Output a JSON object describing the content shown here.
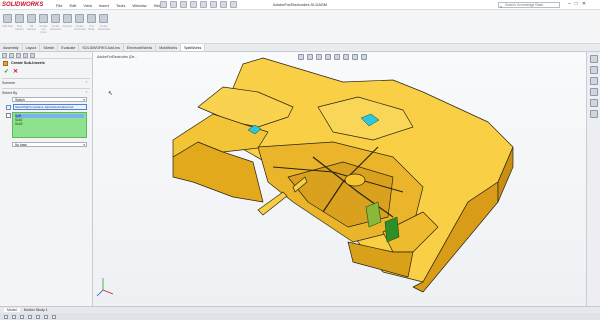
{
  "app": {
    "logo_text": "SOLIDWORKS",
    "document_title": "AdobeForElectrodes.SLDASM"
  },
  "menu": [
    "File",
    "Edit",
    "View",
    "Insert",
    "Tools",
    "Window",
    "Help"
  ],
  "search": {
    "placeholder": "Search Knowledge Base"
  },
  "ribbon": {
    "buttons": [
      "Split Part",
      "Plug Hole(s)",
      "Fill Surface",
      "Create Cut-Lines",
      "Create Extension",
      "Fill Face",
      "Create Protrusion",
      "Trim Body",
      "Create Electrodes"
    ]
  },
  "command_tabs": [
    "Assembly",
    "Layout",
    "Sketch",
    "Evaluate",
    "SOLIDWORKS Add-Ins",
    "ElectrodeWorks",
    "MoldWorks",
    "SplitWorks"
  ],
  "active_command_tab": "SplitWorks",
  "property_manager": {
    "title": "Create Sub-Inserts",
    "scheme_label": "Scheme",
    "select_by_label": "Select By",
    "select_by_value": "Sketch",
    "sketch_selection": "Sketch6@Constrain1-1@AdobeForElectrod",
    "items": [
      "Split",
      "Sub2",
      "Sub3"
    ],
    "selected_item": "Split",
    "bottom_option": "No base"
  },
  "viewport": {
    "breadcrumb": "AdobeForElectrodes (De..."
  },
  "bottom_tabs": [
    "Model",
    "Motion Study 1"
  ],
  "active_bottom_tab": "Model",
  "colors": {
    "part_body": "#f6c531",
    "part_edge": "#2a2410",
    "highlight_teal": "#2fc6dc",
    "electrode_green": "#4cb334",
    "list_green": "#8ee28e"
  },
  "icons": [
    "search-icon",
    "ok-checkmark-icon",
    "cancel-x-icon",
    "coordinate-axes-icon",
    "cursor-icon"
  ]
}
